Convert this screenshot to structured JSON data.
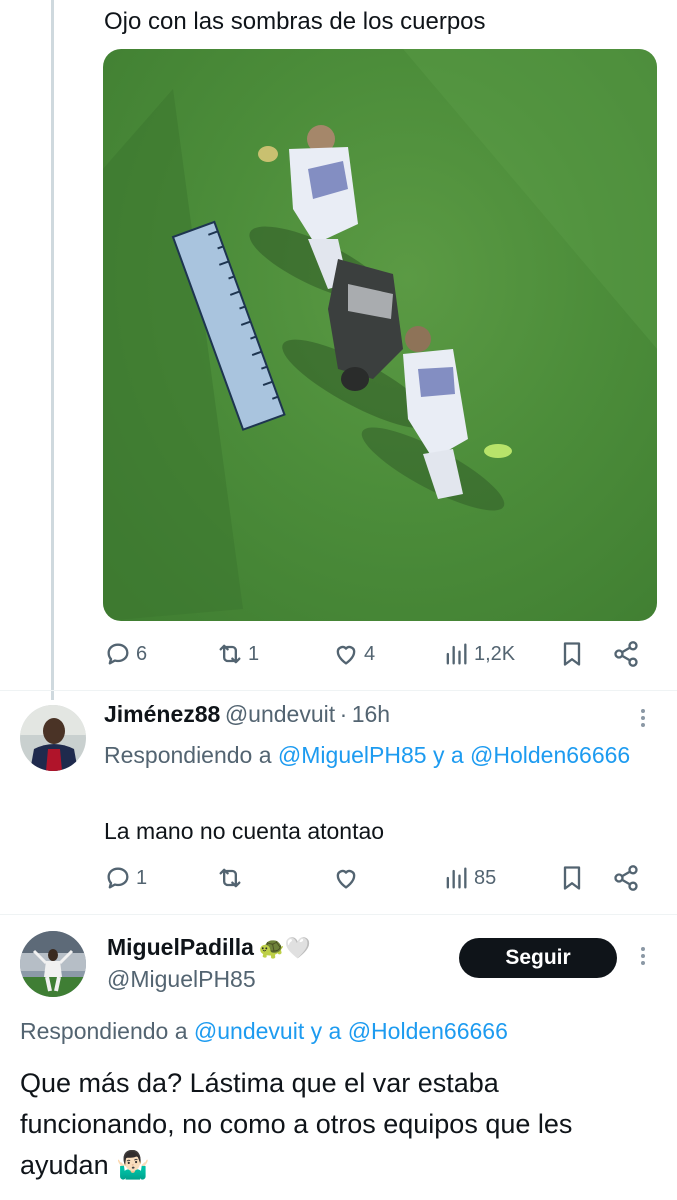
{
  "tweet1": {
    "text": "Ojo con las sombras de los cuerpos",
    "actions": {
      "replies": "6",
      "retweets": "1",
      "likes": "4",
      "views": "1,2K"
    }
  },
  "reply1": {
    "name": "Jiménez88",
    "handle": "@undevuit",
    "sep": "·",
    "time": "16h",
    "replying_prefix": "Respondiendo a",
    "replying_user1": "@MiguelPH85",
    "replying_and": "y a",
    "replying_user2": "@Holden66666",
    "text": "La mano no cuenta atontao",
    "actions": {
      "replies": "1",
      "retweets": "",
      "likes": "",
      "views": "85"
    }
  },
  "tweet2": {
    "name": "MiguelPadilla",
    "name_emojis": "🐢🤍",
    "handle": "@MiguelPH85",
    "follow_label": "Seguir",
    "replying_prefix": "Respondiendo a",
    "replying_user1": "@undevuit",
    "replying_and": "y a",
    "replying_user2": "@Holden66666",
    "text": "Que más da? Lástima que el var estaba funcionando, no como a otros equipos que les ayudan 🤷🏻‍♂️"
  },
  "colors": {
    "link": "#1d9bf0",
    "muted": "#536471",
    "text": "#0f1419",
    "follow_bg": "#0f1419"
  },
  "icons": [
    "reply-icon",
    "retweet-icon",
    "like-icon",
    "views-icon",
    "bookmark-icon",
    "share-icon",
    "more-icon"
  ]
}
